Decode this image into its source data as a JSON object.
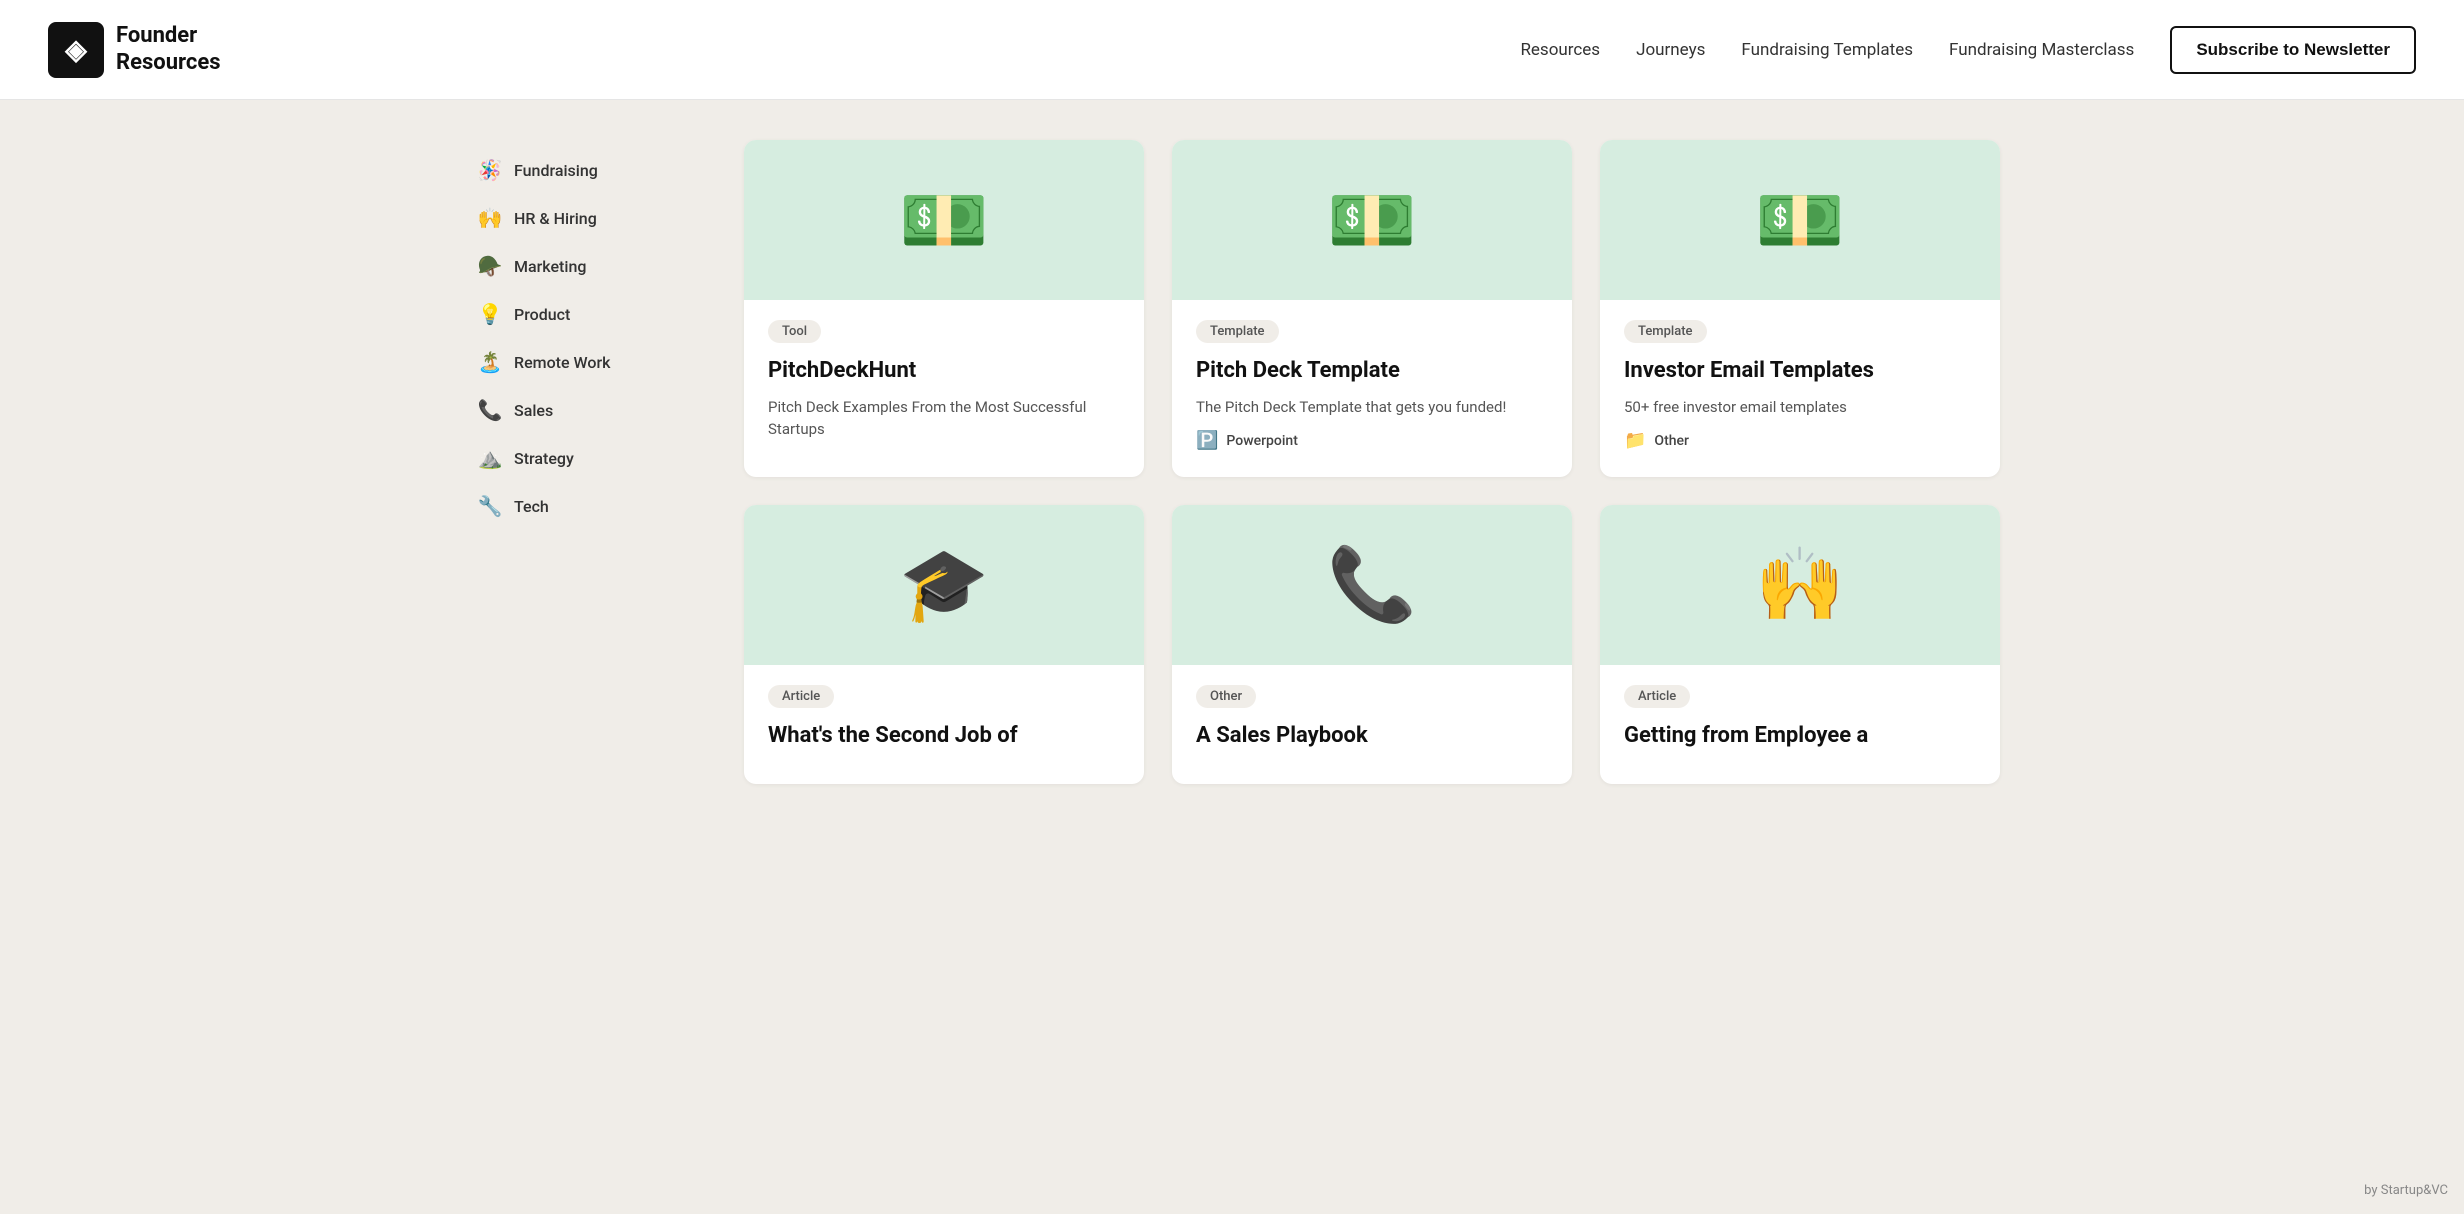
{
  "header": {
    "logo_icon": "◈",
    "logo_text": "Founder\nResources",
    "nav_items": [
      {
        "label": "Resources",
        "id": "resources"
      },
      {
        "label": "Journeys",
        "id": "journeys"
      },
      {
        "label": "Fundraising Templates",
        "id": "fundraising-templates"
      },
      {
        "label": "Fundraising Masterclass",
        "id": "fundraising-masterclass"
      }
    ],
    "subscribe_label": "Subscribe to Newsletter"
  },
  "sidebar": {
    "items": [
      {
        "emoji": "🪅",
        "label": "Fundraising",
        "id": "fundraising"
      },
      {
        "emoji": "🙌",
        "label": "HR & Hiring",
        "id": "hr-hiring"
      },
      {
        "emoji": "🪖",
        "label": "Marketing",
        "id": "marketing"
      },
      {
        "emoji": "💡",
        "label": "Product",
        "id": "product"
      },
      {
        "emoji": "🏝️",
        "label": "Remote Work",
        "id": "remote-work"
      },
      {
        "emoji": "📞",
        "label": "Sales",
        "id": "sales"
      },
      {
        "emoji": "⛰️",
        "label": "Strategy",
        "id": "strategy"
      },
      {
        "emoji": "🔧",
        "label": "Tech",
        "id": "tech"
      }
    ]
  },
  "cards": [
    {
      "id": "pitchdeckhunt",
      "badge": "Tool",
      "title": "PitchDeckHunt",
      "description": "Pitch Deck Examples From the Most Successful Startups",
      "meta_icon": "",
      "meta_label": "",
      "image_emoji": "💵"
    },
    {
      "id": "pitch-deck-template",
      "badge": "Template",
      "title": "Pitch Deck Template",
      "description": "The Pitch Deck Template that gets you funded!",
      "meta_icon": "🅿️",
      "meta_label": "Powerpoint",
      "image_emoji": "💵"
    },
    {
      "id": "investor-email-templates",
      "badge": "Template",
      "title": "Investor Email Templates",
      "description": "50+ free investor email templates",
      "meta_icon": "📁",
      "meta_label": "Other",
      "image_emoji": "💵"
    },
    {
      "id": "second-job",
      "badge": "Article",
      "title": "What's the Second Job of",
      "description": "",
      "meta_icon": "",
      "meta_label": "",
      "image_emoji": "🎓"
    },
    {
      "id": "sales-playbook",
      "badge": "Other",
      "title": "A Sales Playbook",
      "description": "",
      "meta_icon": "",
      "meta_label": "",
      "image_emoji": "📞"
    },
    {
      "id": "getting-from-employee",
      "badge": "Article",
      "title": "Getting from Employee a",
      "description": "",
      "meta_icon": "",
      "meta_label": "",
      "image_emoji": "🙌"
    }
  ],
  "watermark": "by Startup&VC"
}
